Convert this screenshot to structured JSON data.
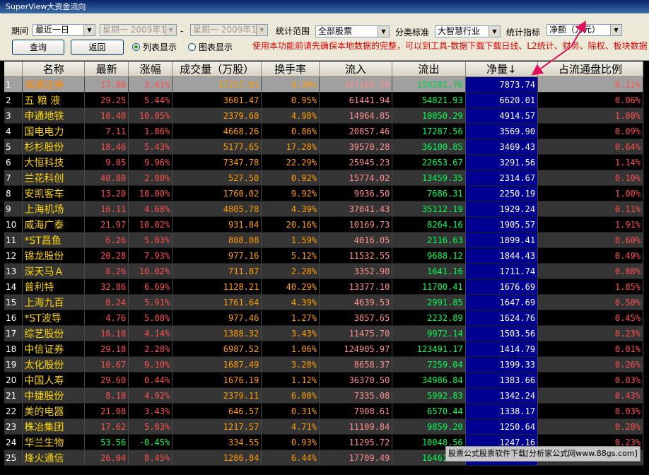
{
  "window": {
    "title": "SuperView大资金流向"
  },
  "controls": {
    "period_label": "期间",
    "period_value": "最近一日",
    "date_from": "星期一 2009年12",
    "date_sep": "-",
    "date_to": "星期一 2009年12",
    "scope_label": "统计范围",
    "scope_value": "全部股票",
    "category_label": "分类标准",
    "category_value": "大智慧行业",
    "metric_label": "统计指标",
    "metric_value": "净额（万元）",
    "query_button": "查询",
    "back_button": "返回",
    "view_list": "列表显示",
    "view_chart": "图表显示",
    "view_selected": "列表显示",
    "notice": "使用本功能前请先确保本地数据的完整，可以到工具-数据下载下载日线、L2统计、财务、除权、板块数据"
  },
  "table": {
    "headers": [
      "",
      "名称",
      "最新",
      "涨幅",
      "成交量（万股）",
      "换手率",
      "流入",
      "流出",
      "净量↓",
      "占流通盘比例"
    ],
    "sort_column": "净量",
    "rows": [
      [
        "1",
        "海通证券",
        "17.88",
        "3.41%",
        "17217.01",
        "4.30%",
        "167165.50",
        "159291.76",
        "7873.74",
        "0.11%"
      ],
      [
        "2",
        "五 粮 液",
        "29.25",
        "5.44%",
        "3601.47",
        "0.95%",
        "61441.94",
        "54821.93",
        "6620.01",
        "0.06%"
      ],
      [
        "3",
        "申通地铁",
        "10.40",
        "10.05%",
        "2379.60",
        "4.98%",
        "14964.85",
        "10050.29",
        "4914.57",
        "1.00%"
      ],
      [
        "4",
        "国电电力",
        "7.11",
        "1.86%",
        "4668.26",
        "0.86%",
        "20857.46",
        "17287.56",
        "3569.90",
        "0.09%"
      ],
      [
        "5",
        "杉杉股份",
        "18.46",
        "5.43%",
        "5177.65",
        "17.28%",
        "39570.28",
        "36100.85",
        "3469.43",
        "0.64%"
      ],
      [
        "6",
        "大恒科技",
        "9.05",
        "9.96%",
        "7347.78",
        "22.29%",
        "25945.23",
        "22653.67",
        "3291.56",
        "1.14%"
      ],
      [
        "7",
        "兰花科创",
        "40.80",
        "2.00%",
        "527.50",
        "0.92%",
        "15774.02",
        "13459.35",
        "2314.67",
        "0.10%"
      ],
      [
        "8",
        "安凯客车",
        "13.20",
        "10.00%",
        "1760.02",
        "9.92%",
        "9936.50",
        "7686.31",
        "2250.19",
        "1.00%"
      ],
      [
        "9",
        "上海机场",
        "16.11",
        "4.68%",
        "4805.78",
        "4.39%",
        "37041.43",
        "35112.19",
        "1929.24",
        "0.11%"
      ],
      [
        "10",
        "威海广泰",
        "21.97",
        "10.02%",
        "931.84",
        "20.16%",
        "10169.73",
        "8264.16",
        "1905.57",
        "1.91%"
      ],
      [
        "11",
        "*ST昌鱼",
        "6.26",
        "5.03%",
        "808.08",
        "1.59%",
        "4016.05",
        "2116.63",
        "1899.41",
        "0.60%"
      ],
      [
        "12",
        "锦龙股份",
        "20.28",
        "7.93%",
        "977.16",
        "5.12%",
        "11532.55",
        "9688.12",
        "1844.43",
        "0.49%"
      ],
      [
        "13",
        "深天马Ａ",
        "6.26",
        "10.02%",
        "711.87",
        "2.28%",
        "3352.90",
        "1641.16",
        "1711.74",
        "0.88%"
      ],
      [
        "14",
        "普利特",
        "32.86",
        "6.69%",
        "1128.21",
        "40.29%",
        "13377.10",
        "11700.41",
        "1676.69",
        "1.85%"
      ],
      [
        "15",
        "上海九百",
        "8.24",
        "5.91%",
        "1761.64",
        "4.39%",
        "4639.53",
        "2991.85",
        "1647.69",
        "0.50%"
      ],
      [
        "16",
        "*ST波导",
        "4.76",
        "5.08%",
        "977.46",
        "1.27%",
        "3857.65",
        "2232.89",
        "1624.76",
        "0.45%"
      ],
      [
        "17",
        "综艺股份",
        "16.10",
        "4.14%",
        "1388.32",
        "3.43%",
        "11475.70",
        "9972.14",
        "1503.56",
        "0.23%"
      ],
      [
        "18",
        "中信证券",
        "29.18",
        "2.28%",
        "6987.52",
        "1.06%",
        "124905.97",
        "123491.17",
        "1414.79",
        "0.01%"
      ],
      [
        "19",
        "太化股份",
        "10.67",
        "9.10%",
        "1687.49",
        "3.28%",
        "8658.37",
        "7259.04",
        "1399.33",
        "0.26%"
      ],
      [
        "20",
        "中国人寿",
        "29.60",
        "0.44%",
        "1676.19",
        "1.12%",
        "36370.50",
        "34986.84",
        "1383.66",
        "0.03%"
      ],
      [
        "21",
        "中捷股份",
        "8.10",
        "4.92%",
        "2379.11",
        "6.00%",
        "7335.08",
        "5992.83",
        "1342.24",
        "0.43%"
      ],
      [
        "22",
        "美的电器",
        "21.08",
        "3.43%",
        "646.57",
        "0.31%",
        "7908.61",
        "6570.44",
        "1338.17",
        "0.03%"
      ],
      [
        "23",
        "株冶集团",
        "17.62",
        "5.83%",
        "1217.57",
        "4.71%",
        "11109.84",
        "9859.20",
        "1250.64",
        "0.28%"
      ],
      [
        "24",
        "华兰生物",
        "53.56",
        "-0.45%",
        "334.55",
        "0.93%",
        "11295.72",
        "10048.56",
        "1247.16",
        "0.23%"
      ],
      [
        "25",
        "烽火通信",
        "26.04",
        "8.45%",
        "1286.84",
        "6.44%",
        "17709.49",
        "16461.25",
        "1248.24",
        "0.50%"
      ]
    ]
  },
  "watermark": "股票公式股票软件下载[分析家公式网www.88gs.com]",
  "colors": {
    "positive": "#ff5050",
    "negative": "#00ff55",
    "name": "#ffd700",
    "net_column_bg": "#000090",
    "annotation_arrow": "#e0105a"
  }
}
